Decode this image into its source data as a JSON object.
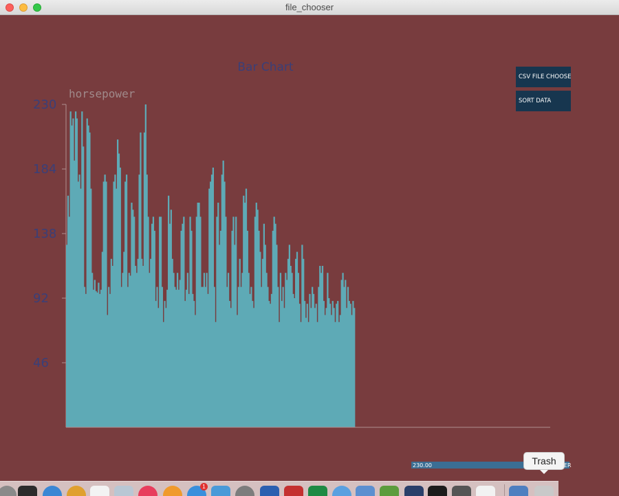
{
  "window": {
    "title": "file_chooser"
  },
  "buttons": {
    "csv_label": "CSV FILE CHOOSER",
    "sort_label": "SORT DATA"
  },
  "slider": {
    "value_text": "230.00",
    "caption_text": "ER",
    "level": 1.0
  },
  "tooltip": {
    "text": "Trash"
  },
  "dock": {
    "appstore_badge": "1",
    "icons": [
      {
        "name": "launchpad-icon",
        "color": "#8a8a8a",
        "round": true
      },
      {
        "name": "activity-monitor-icon",
        "color": "#2c2c2c"
      },
      {
        "name": "safari-icon",
        "color": "#3b87d4",
        "round": true
      },
      {
        "name": "chrome-icon",
        "color": "#e0a030",
        "round": true
      },
      {
        "name": "calendar-icon",
        "color": "#f3f3f3"
      },
      {
        "name": "preview-icon",
        "color": "#b9c7d4"
      },
      {
        "name": "itunes-icon",
        "color": "#e83d5d",
        "round": true
      },
      {
        "name": "ibooks-icon",
        "color": "#f09a2c",
        "round": true
      },
      {
        "name": "app-store-icon",
        "color": "#3a8fdc",
        "round": true
      },
      {
        "name": "xcode-icon",
        "color": "#4a9ad8"
      },
      {
        "name": "system-preferences-icon",
        "color": "#7d7d7d",
        "round": true
      },
      {
        "name": "word-icon",
        "color": "#2b5fb0"
      },
      {
        "name": "red-app-icon",
        "color": "#c43030"
      },
      {
        "name": "excel-icon",
        "color": "#1e8a44"
      },
      {
        "name": "network-icon",
        "color": "#5aa0e0",
        "round": true
      },
      {
        "name": "finder-folder-icon",
        "color": "#5c8fd0"
      },
      {
        "name": "green-app-icon",
        "color": "#5c9c3c"
      },
      {
        "name": "processing-icon",
        "color": "#2a3f6a"
      },
      {
        "name": "terminal-icon",
        "color": "#1c1c1c"
      },
      {
        "name": "sublime-text-icon",
        "color": "#555555"
      },
      {
        "name": "java-icon",
        "color": "#f2f2f2"
      },
      {
        "name": "downloads-folder-icon",
        "color": "#4e7fc0"
      },
      {
        "name": "trash-icon",
        "color": "#c9c9c9"
      }
    ]
  },
  "colors": {
    "background": "#783c3e",
    "bar": "#5eaab6",
    "accent_text": "#3a3f78",
    "button": "#17364f"
  },
  "chart_data": {
    "type": "bar",
    "title": "Bar Chart",
    "series_label": "horsepower",
    "y_ticks": [
      46,
      92,
      138,
      184,
      230
    ],
    "ylim": [
      0,
      230
    ],
    "grid": false,
    "values": [
      130,
      165,
      150,
      225,
      215,
      220,
      190,
      225,
      220,
      175,
      180,
      170,
      225,
      200,
      100,
      95,
      220,
      215,
      210,
      170,
      110,
      98,
      105,
      97,
      96,
      103,
      95,
      98,
      125,
      175,
      180,
      175,
      80,
      100,
      95,
      120,
      115,
      175,
      180,
      170,
      205,
      195,
      185,
      100,
      110,
      125,
      175,
      180,
      100,
      110,
      108,
      160,
      155,
      150,
      115,
      110,
      120,
      180,
      210,
      120,
      115,
      210,
      230,
      180,
      150,
      110,
      120,
      145,
      150,
      140,
      90,
      100,
      85,
      150,
      150,
      100,
      75,
      90,
      85,
      98,
      165,
      145,
      155,
      120,
      110,
      100,
      98,
      110,
      98,
      105,
      140,
      145,
      150,
      90,
      98,
      110,
      95,
      150,
      140,
      95,
      90,
      80,
      150,
      160,
      160,
      150,
      100,
      100,
      110,
      100,
      110,
      95,
      170,
      175,
      180,
      185,
      100,
      75,
      150,
      160,
      130,
      140,
      180,
      190,
      175,
      150,
      100,
      110,
      90,
      85,
      140,
      150,
      130,
      150,
      80,
      100,
      120,
      100,
      110,
      165,
      160,
      170,
      140,
      110,
      95,
      100,
      90,
      85,
      150,
      160,
      155,
      140,
      125,
      100,
      120,
      145,
      130,
      110,
      100,
      90,
      88,
      95,
      140,
      150,
      145,
      130,
      100,
      75,
      110,
      90,
      100,
      85,
      110,
      105,
      120,
      130,
      115,
      110,
      95,
      92,
      120,
      125,
      110,
      88,
      75,
      130,
      120,
      90,
      78,
      88,
      75,
      95,
      85,
      100,
      95,
      85,
      88,
      75,
      100,
      115,
      110,
      115,
      90,
      80,
      85,
      110,
      92,
      88,
      80,
      90,
      85,
      75,
      88,
      90,
      75,
      80,
      105,
      110,
      100,
      105,
      85,
      100,
      90,
      88,
      80,
      90,
      85
    ]
  }
}
